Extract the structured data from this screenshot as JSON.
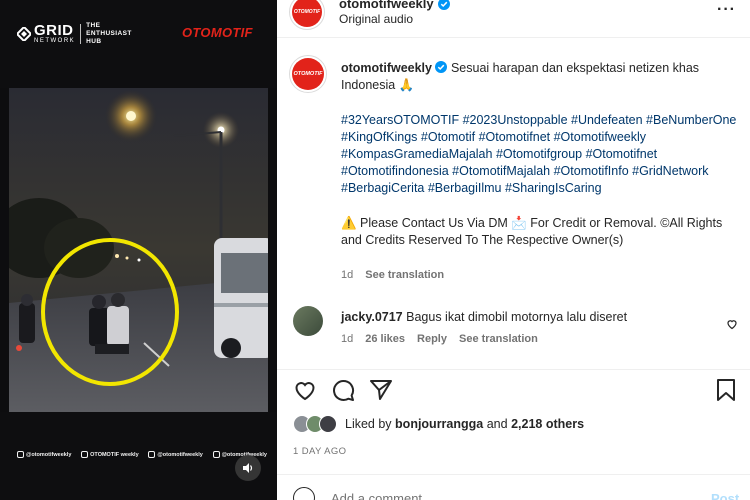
{
  "video": {
    "brand_left": "GRID",
    "brand_left_sub": "NETWORK",
    "brand_left_tagline": [
      "THE",
      "ENTHUSIAST",
      "HUB"
    ],
    "brand_right": "OTOMOTIF",
    "socials": [
      {
        "icon": "instagram-icon",
        "handle": "@otomotifweekly"
      },
      {
        "icon": "facebook-icon",
        "handle": "OTOMOTIF weekly"
      },
      {
        "icon": "twitter-icon",
        "handle": "@otomotifweekly"
      },
      {
        "icon": "tiktok-icon",
        "handle": "@otomotifweekly"
      }
    ],
    "mute_icon": "speaker-icon",
    "highlight_color": "#f2e600"
  },
  "header": {
    "username": "otomotifweekly",
    "subtitle": "Original audio",
    "avatar_text": "OTOMOTIF",
    "more_icon": "more-horizontal-icon"
  },
  "caption": {
    "username": "otomotifweekly",
    "text": "Sesuai harapan dan ekspektasi netizen khas Indonesia 🙏",
    "hashtags": "#32YearsOTOMOTIF #2023Unstoppable #Undefeaten #BeNumberOne #KingOfKings #Otomotif #Otomotifnet #Otomotifweekly #KompasGramediaMajalah #Otomotifgroup #Otomotifnet #Otomotifindonesia #OtomotifMajalah #OtomotifInfo #GridNetwork #BerbagiCerita #BerbagiIlmu #SharingIsCaring",
    "credit": "⚠️ Please Contact Us Via DM 📩 For Credit or Removal. ©All Rights and Credits Reserved To The Respective Owner(s)",
    "time": "1d",
    "see_translation": "See translation"
  },
  "comment": {
    "username": "jacky.0717",
    "text": "Bagus ikat dimobil motornya lalu diseret",
    "time": "1d",
    "likes": "26 likes",
    "reply": "Reply",
    "see_translation": "See translation"
  },
  "actions": {
    "like_icon": "heart-icon",
    "comment_icon": "comment-icon",
    "share_icon": "send-icon",
    "save_icon": "bookmark-icon"
  },
  "likes": {
    "prefix": "Liked by",
    "user": "bonjourrangga",
    "suffix": "and",
    "others": "2,218 others"
  },
  "date": "1 DAY AGO",
  "add_comment": {
    "placeholder": "Add a comment…",
    "post_label": "Post"
  },
  "colors": {
    "brand_red": "#e2231a",
    "hashtag_blue": "#00376b",
    "verified_blue": "#0095f6",
    "post_disabled": "#b2dffc"
  }
}
